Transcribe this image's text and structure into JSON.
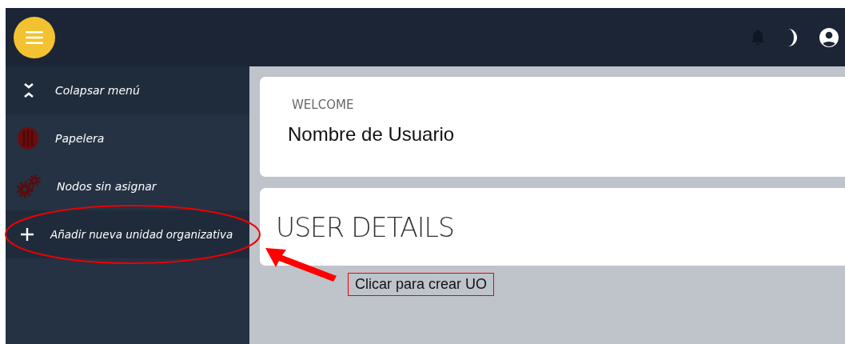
{
  "sidebar": {
    "items": [
      {
        "kind": "collapse",
        "label": "Colapsar menú"
      },
      {
        "kind": "trash",
        "label": "Papelera"
      },
      {
        "kind": "gears",
        "label": "Nodos sin asignar"
      },
      {
        "kind": "add",
        "label": "Añadir nueva unidad organizativa"
      }
    ]
  },
  "welcome": {
    "caption": "WELCOME",
    "name": "Nombre de Usuario"
  },
  "details": {
    "title": "USER DETAILS"
  },
  "annotation": {
    "callout": "Clicar para crear UO"
  }
}
